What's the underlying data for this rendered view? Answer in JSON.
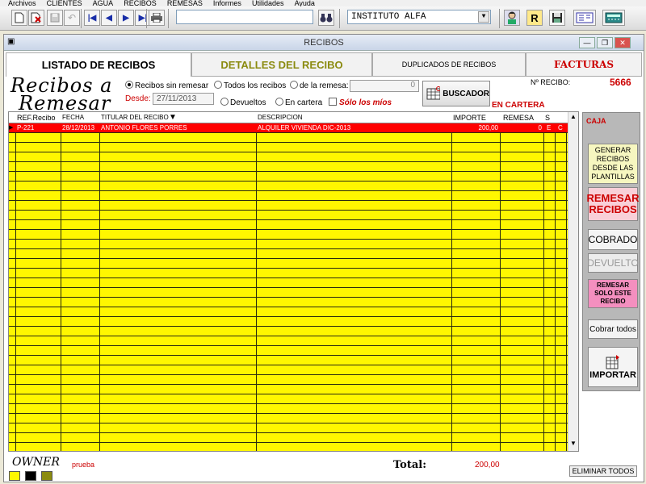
{
  "menu": [
    "Archivos",
    "CLIENTES",
    "AGUA",
    "RECIBOS",
    "REMESAS",
    "Informes",
    "Utilidades",
    "Ayuda"
  ],
  "toolbar": {
    "company": "INSTITUTO ALFA",
    "search_value": "",
    "r_label": "R"
  },
  "window": {
    "title": "RECIBOS"
  },
  "tabs": {
    "listado": "LISTADO DE RECIBOS",
    "detalles": "DETALLES DEL RECIBO",
    "duplicados": "DUPLICADOS DE RECIBOS",
    "facturas": "FACTURAS"
  },
  "logo": {
    "line1": "Recibos a",
    "line2": "Remesar"
  },
  "filters": {
    "sin_remesar": "Recibos sin remesar",
    "todos": "Todos los recibos",
    "de_la_remesa": "de la remesa:",
    "remesa_value": "0",
    "desde_label": "Desde:",
    "desde_value": "27/11/2013",
    "devueltos": "Devueltos",
    "en_cartera": "En cartera",
    "solo_mios": "Sólo los míos",
    "buscador": "BUSCADOR",
    "status": "EN CARTERA"
  },
  "recibo": {
    "label": "Nº RECIBO:",
    "value": "5666"
  },
  "grid": {
    "headers": {
      "ref": "REF.Recibo",
      "fecha": "FECHA",
      "titular": "TITULAR DEL RECIBO",
      "descripcion": "DESCRIPCION",
      "importe": "IMPORTE",
      "remesa": "REMESA",
      "s": "S"
    },
    "rows": [
      {
        "ref": "P-221",
        "fecha": "28/12/2013",
        "titular": "ANTONIO FLORES PORRES",
        "descripcion": "ALQUILER VIVIENDA DIC-2013",
        "importe": "200,00",
        "remesa": "0",
        "e": "E",
        "c": "C"
      }
    ]
  },
  "side": {
    "caja": "CAJA",
    "generar": "GENERAR RECIBOS DESDE LAS PLANTILLAS",
    "remesar": "REMESAR RECIBOS",
    "cobrado": "COBRADO",
    "devuelto": "DEVUELTO",
    "remesar_solo": "REMESAR SOLO ESTE RECIBO",
    "cobrar_todos": "Cobrar todos",
    "importar": "IMPORTAR"
  },
  "footer": {
    "owner": "OWNER",
    "owner_name": "prueba",
    "total_label": "Total:",
    "total_value": "200,00",
    "eliminar": "ELIMINAR TODOS"
  },
  "colors": {
    "grid_yellow": "#fff700",
    "selected_row": "#ff0000",
    "accent_red": "#cc0000",
    "side_panel": "#b8b8b8",
    "swatch1": "#fff700",
    "swatch2": "#000000",
    "swatch3": "#8b8b10"
  }
}
